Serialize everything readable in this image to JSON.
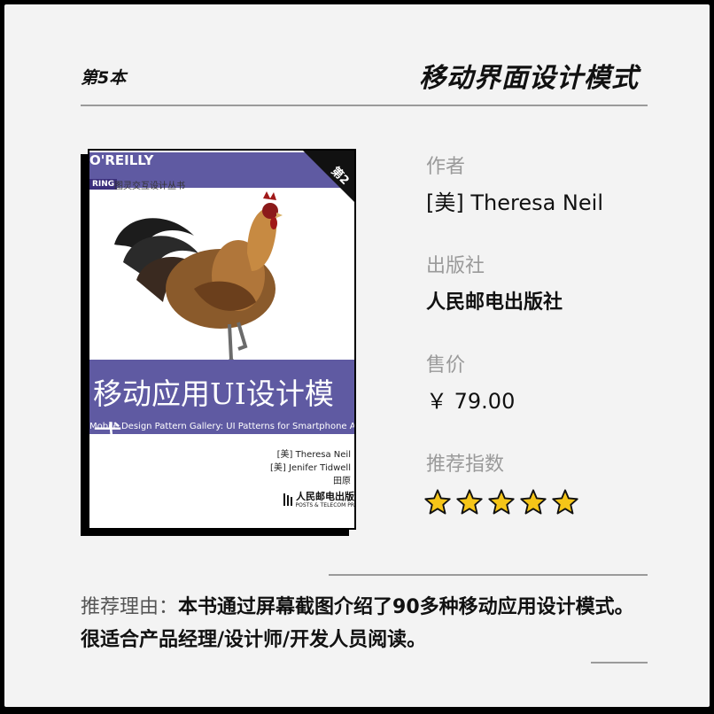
{
  "header": {
    "rank": "第5本",
    "title": "移动界面设计模式"
  },
  "cover": {
    "brand": "O'REILLY",
    "corner_text": "第2",
    "series_tag": "RING",
    "series_text": "图灵交互设计丛书",
    "title": "移动应用UI设计模式",
    "subtitle": "Mobile Design Pattern Gallery: UI Patterns for Smartphone Apps",
    "author_line_1": "[美] Theresa Neil",
    "author_line_2": "[美] Jenifer Tidwell",
    "translator": "田原",
    "publisher": "人民邮电出版",
    "publisher_en": "POSTS & TELECOM PR",
    "band_color": "#5f5aa2"
  },
  "info": {
    "author_label": "作者",
    "author_value": "[美] Theresa Neil",
    "publisher_label": "出版社",
    "publisher_value": "人民邮电出版社",
    "price_label": "售价",
    "price_value": "￥ 79.00",
    "rating_label": "推荐指数",
    "rating": 5,
    "rating_max": 5,
    "star_color": "#f5c518"
  },
  "reason": {
    "label": "推荐理由：",
    "text": "本书通过屏幕截图介绍了90多种移动应用设计模式。很适合产品经理/设计师/开发人员阅读。"
  }
}
